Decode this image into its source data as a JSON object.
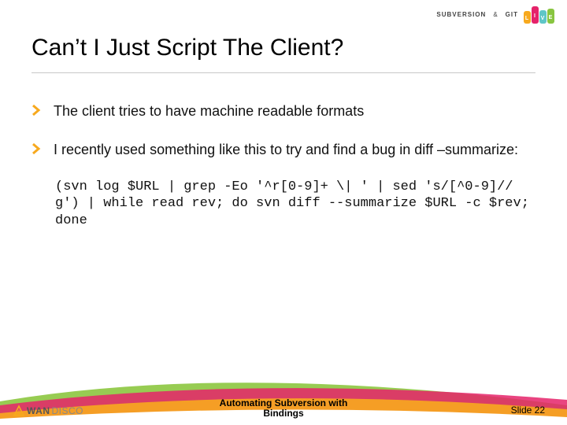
{
  "header": {
    "brand_left": "SUBVERSION",
    "brand_amp": "&",
    "brand_right": "GIT",
    "live": [
      "L",
      "I",
      "V",
      "E"
    ]
  },
  "title": "Can’t I Just Script The Client?",
  "bullets": [
    "The client tries to have machine readable formats",
    "I recently used something like this to try and find a bug in diff –summarize:"
  ],
  "code": "(svn log $URL | grep -Eo '^r[0-9]+ \\| ' | sed 's/[^0-9]//g') | while read rev; do svn diff --summarize $URL -c $rev; done",
  "footer": {
    "presentation_title_line1": "Automating Subversion with",
    "presentation_title_line2": "Bindings",
    "slide_label": "Slide 22",
    "company_prefix": "WAN",
    "company_suffix": "DISCO"
  }
}
